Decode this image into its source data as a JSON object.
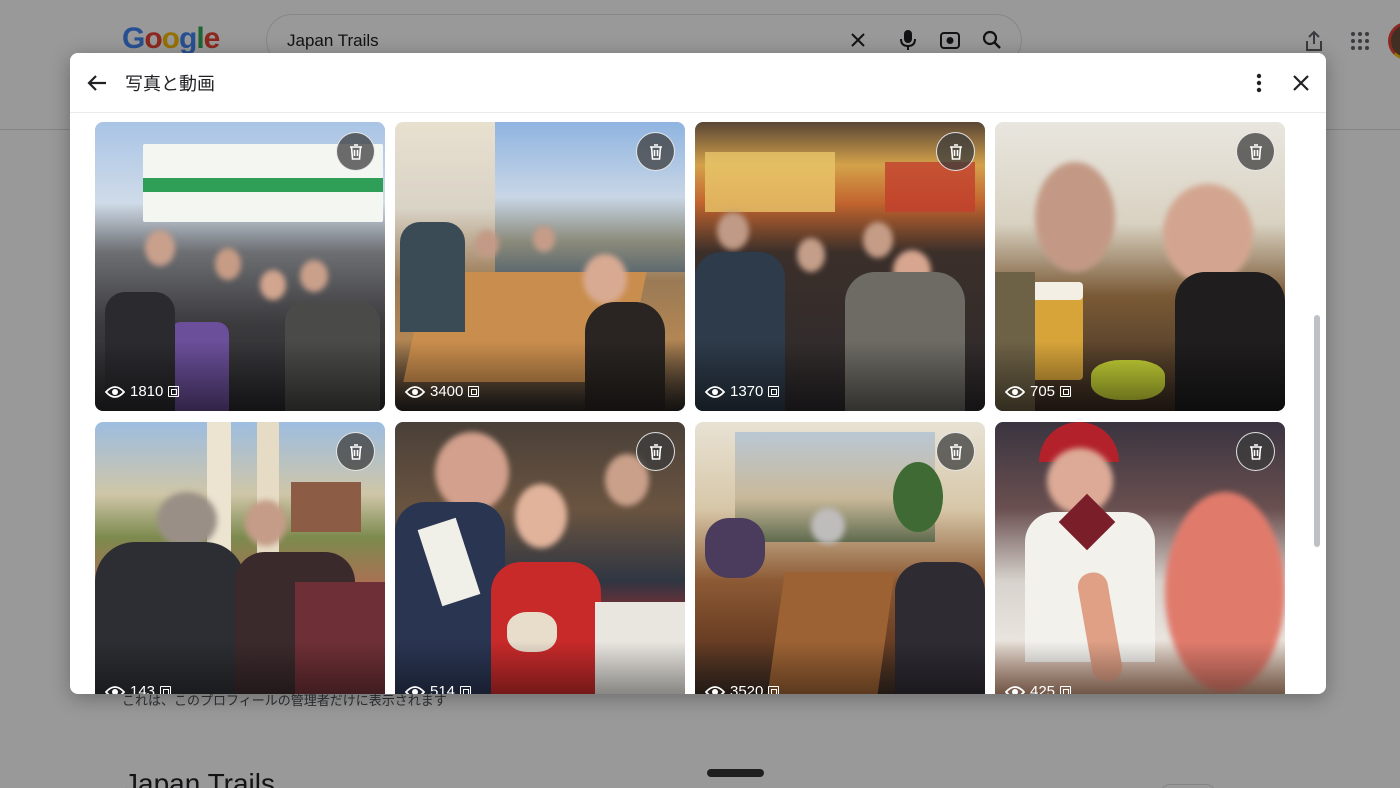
{
  "background": {
    "logo": [
      "G",
      "o",
      "o",
      "g",
      "l",
      "e"
    ],
    "search": {
      "query": "Japan Trails"
    },
    "note": "これは、このプロフィールの管理者だけに表示されます",
    "profile_title": "Japan Trails"
  },
  "modal": {
    "title": "写真と動画",
    "photos": [
      {
        "views": "1810"
      },
      {
        "views": "3400"
      },
      {
        "views": "1370"
      },
      {
        "views": "705"
      },
      {
        "views": "143"
      },
      {
        "views": "514"
      },
      {
        "views": "3520"
      },
      {
        "views": "425"
      }
    ]
  },
  "icons": {
    "back": "arrow-left-icon",
    "more": "more-vert-icon",
    "close": "close-icon",
    "delete": "trash-icon",
    "views": "eye-icon",
    "panorama": "panorama-icon"
  },
  "colors": {
    "overlay": "#000000",
    "accent_blue": "#4285f4"
  }
}
